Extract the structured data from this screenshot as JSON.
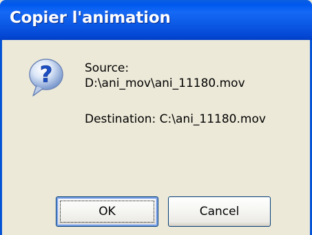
{
  "window": {
    "title": "Copier l'animation"
  },
  "icon": {
    "name": "question-icon",
    "glyph": "?",
    "color": "#2a62d8"
  },
  "message": {
    "source_label": "Source:",
    "source_path": "D:\\ani_mov\\ani_11180.mov",
    "destination_line": "Destination: C:\\ani_11180.mov"
  },
  "buttons": {
    "ok_label": "OK",
    "cancel_label": "Cancel"
  },
  "colors": {
    "titlebar": "#0058ee",
    "dialog_bg": "#ece9d8"
  }
}
